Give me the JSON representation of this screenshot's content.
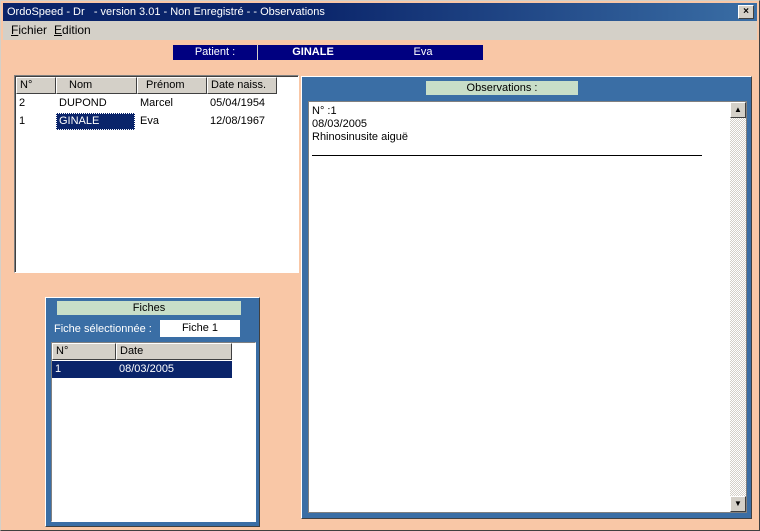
{
  "window": {
    "title": "OrdoSpeed - Dr   - version 3.01 - Non Enregistré - - Observations",
    "close_label": "×"
  },
  "menu": [
    {
      "accel": "F",
      "rest": "ichier"
    },
    {
      "accel": "E",
      "rest": "dition"
    }
  ],
  "patient": {
    "label": "Patient :",
    "nom": "GINALE",
    "prenom": "Eva"
  },
  "patients_table": {
    "headers": [
      "N°",
      "Nom",
      "Prénom",
      "Date naiss."
    ],
    "rows": [
      [
        "2",
        "DUPOND",
        "Marcel",
        "05/04/1954"
      ],
      [
        "1",
        "GINALE",
        "Eva",
        "12/08/1967"
      ]
    ]
  },
  "fiches": {
    "title": "Fiches",
    "selected_label": "Fiche sélectionnée :",
    "selected_value": "Fiche 1",
    "headers": [
      "N°",
      "Date"
    ],
    "rows": [
      [
        "1",
        "08/03/2005"
      ]
    ]
  },
  "observations": {
    "title": "Observations :",
    "lines": [
      "N° :1",
      "08/03/2005",
      "Rhinosinusite aiguë"
    ]
  },
  "colors": {
    "background": "#f9c7a6",
    "panel": "#3a6ea5",
    "selection": "#0a246a",
    "title_green": "#c8dec8"
  },
  "icons": {
    "scroll_up": "triangle-up-icon",
    "scroll_down": "triangle-down-icon"
  }
}
